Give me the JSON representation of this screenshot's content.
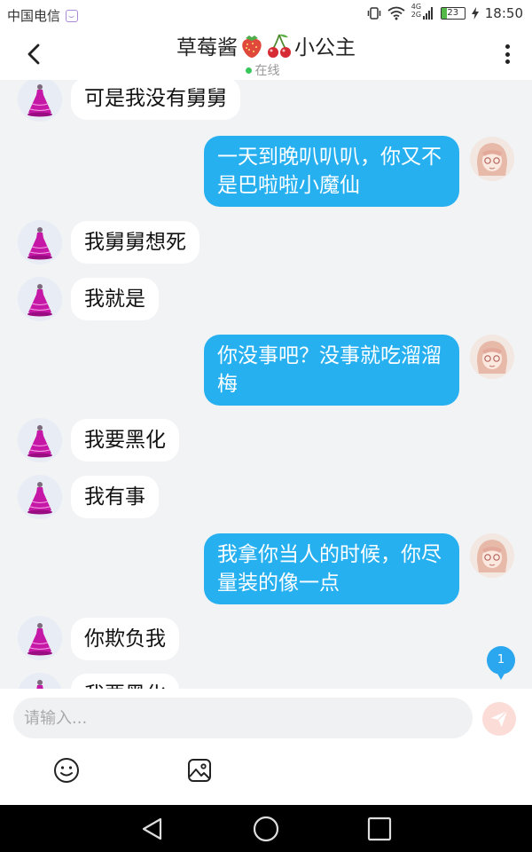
{
  "status_bar": {
    "carrier": "中国电信",
    "network_top": "4G",
    "network_bottom": "2G",
    "battery": "23",
    "time": "18:50"
  },
  "header": {
    "title_prefix": "草莓酱",
    "title_suffix": "小公主",
    "status": "在线"
  },
  "messages": [
    {
      "side": "left",
      "text": "可是我没有舅舅"
    },
    {
      "side": "right",
      "text": "一天到晚叭叭叭，你又不是巴啦啦小魔仙"
    },
    {
      "side": "left",
      "text": "我舅舅想死"
    },
    {
      "side": "left",
      "text": "我就是"
    },
    {
      "side": "right",
      "text": "你没事吧？没事就吃溜溜梅"
    },
    {
      "side": "left",
      "text": "我要黑化"
    },
    {
      "side": "left",
      "text": "我有事"
    },
    {
      "side": "right",
      "text": "我拿你当人的时候，你尽量装的像一点"
    },
    {
      "side": "left",
      "text": "你欺负我"
    },
    {
      "side": "left",
      "text": "我要黑化"
    }
  ],
  "unread_count": "1",
  "input": {
    "placeholder": "请输入..."
  },
  "icons": {
    "back": "back-arrow-icon",
    "more": "more-vertical-icon",
    "send": "send-paper-plane-icon",
    "emoji": "emoji-smile-icon",
    "image": "image-icon"
  },
  "colors": {
    "outgoing_bubble": "#27b0f0",
    "incoming_bubble": "#ffffff",
    "chat_background": "#f2f3f5",
    "online_dot": "#38c85a"
  }
}
